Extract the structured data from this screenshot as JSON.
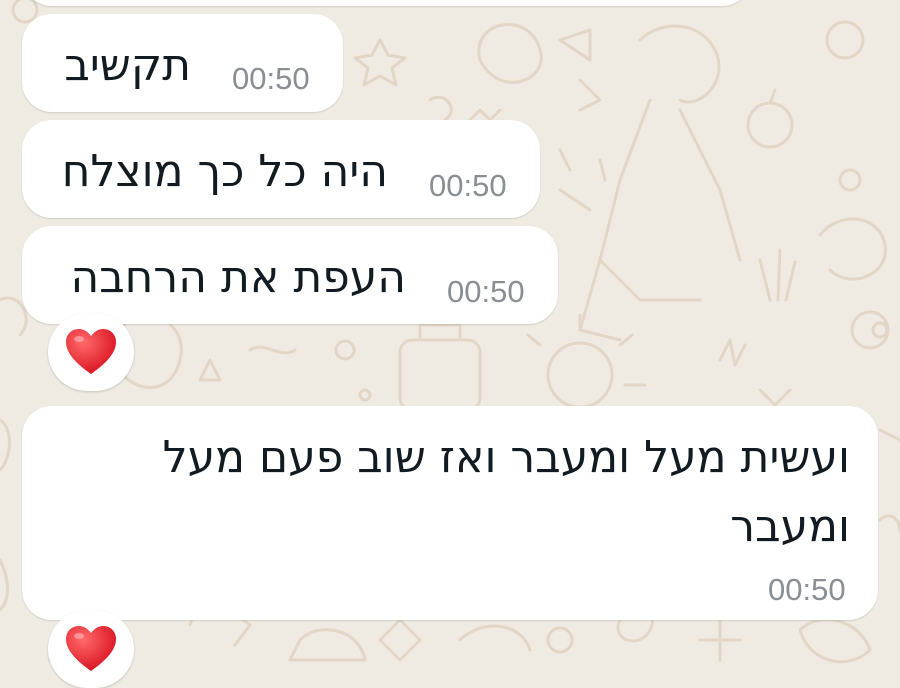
{
  "messages": [
    {
      "text": "",
      "time": ""
    },
    {
      "text": "תקשיב",
      "time": "00:50"
    },
    {
      "text": "היה כל כך מוצלח",
      "time": "00:50"
    },
    {
      "text": "העפת את הרחבה",
      "time": "00:50",
      "reaction": "❤️"
    },
    {
      "text_line1": "ועשית מעל ומעבר ואז שוב פעם מעל",
      "text_line2": "ומעבר",
      "time": "00:50",
      "reaction": "❤️"
    }
  ],
  "colors": {
    "wallpaper": "#efeae2",
    "doodle": "#e3d9c9",
    "bubble": "#ffffff",
    "text": "#111b21",
    "time": "#8a8f93",
    "heart": "#e8232f"
  },
  "icons": [
    "heart-reaction-icon",
    "chat-wallpaper-doodles"
  ]
}
